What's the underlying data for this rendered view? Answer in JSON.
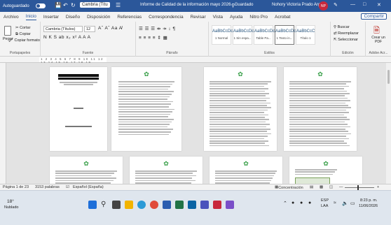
{
  "titlebar": {
    "autosave_label": "Autoguardado",
    "font_value": "Cambria (Títu",
    "doc_title": "Informe de Calidad de la información mayo 2026 · Guardado",
    "search_icon": "search-icon",
    "user_name": "Nohory Victoria Prado Argaño",
    "avatar_initials": "NP"
  },
  "menu": {
    "items": [
      "Archivo",
      "Inicio",
      "Insertar",
      "Diseño",
      "Disposición",
      "Referencias",
      "Correspondencia",
      "Revisar",
      "Vista",
      "Ayuda",
      "Nitro Pro",
      "Acrobat"
    ],
    "active": "Inicio",
    "share_label": "Compartir"
  },
  "ribbon": {
    "clipboard": {
      "paste_label": "Pegar",
      "cut_label": "Cortar",
      "copy_label": "Copiar",
      "format_painter_label": "Copiar formato",
      "group_label": "Portapapeles"
    },
    "font": {
      "font_name": "Cambria (Títulos)",
      "font_size": "12",
      "row1_tools": "Aˆ Aˇ Aa A̸",
      "row2_tools": "N K S ab x₂ x² A A A",
      "group_label": "Fuente"
    },
    "paragraph": {
      "row1_tools": "☰ ☰ ☰ ⇹ ⇸ ↕ ¶",
      "row2_tools": "≡ ≡ ≡ ≡ ⇕ ▦",
      "group_label": "Párrafo"
    },
    "styles": {
      "items": [
        {
          "sample": "AaBbCcDc",
          "name": "1 Normal"
        },
        {
          "sample": "AaBbCcDc",
          "name": "1 Sin espa..."
        },
        {
          "sample": "AaBbCcDc",
          "name": "Table Pa..."
        },
        {
          "sample": "AaBbCcDc",
          "name": "1 Texto in..."
        },
        {
          "sample": "AaBbCcC",
          "name": "Título 1"
        }
      ],
      "selected_index": 3,
      "group_label": "Estilos"
    },
    "editing": {
      "find_label": "Buscar",
      "replace_label": "Reemplazar",
      "select_label": "Seleccionar",
      "group_label": "Edición"
    },
    "adobe": {
      "create_pdf_label": "Crear un PDF",
      "group_label": "Adobe Acr..."
    }
  },
  "ruler": {
    "marks": "1 2 3 4 5 6 7 8 9 10 11 12 13 14 15 16 17 18 19"
  },
  "status": {
    "page_info": "Página 1 de 23",
    "word_count": "3153 palabras",
    "language": "Español (España)",
    "focus_label": "Concentración"
  },
  "taskbar": {
    "weather_temp": "18°",
    "weather_label": "Nublado",
    "lang_code": "ESP",
    "lang_region": "LAA",
    "time": "8:23 p. m.",
    "date": "11/06/2026"
  }
}
